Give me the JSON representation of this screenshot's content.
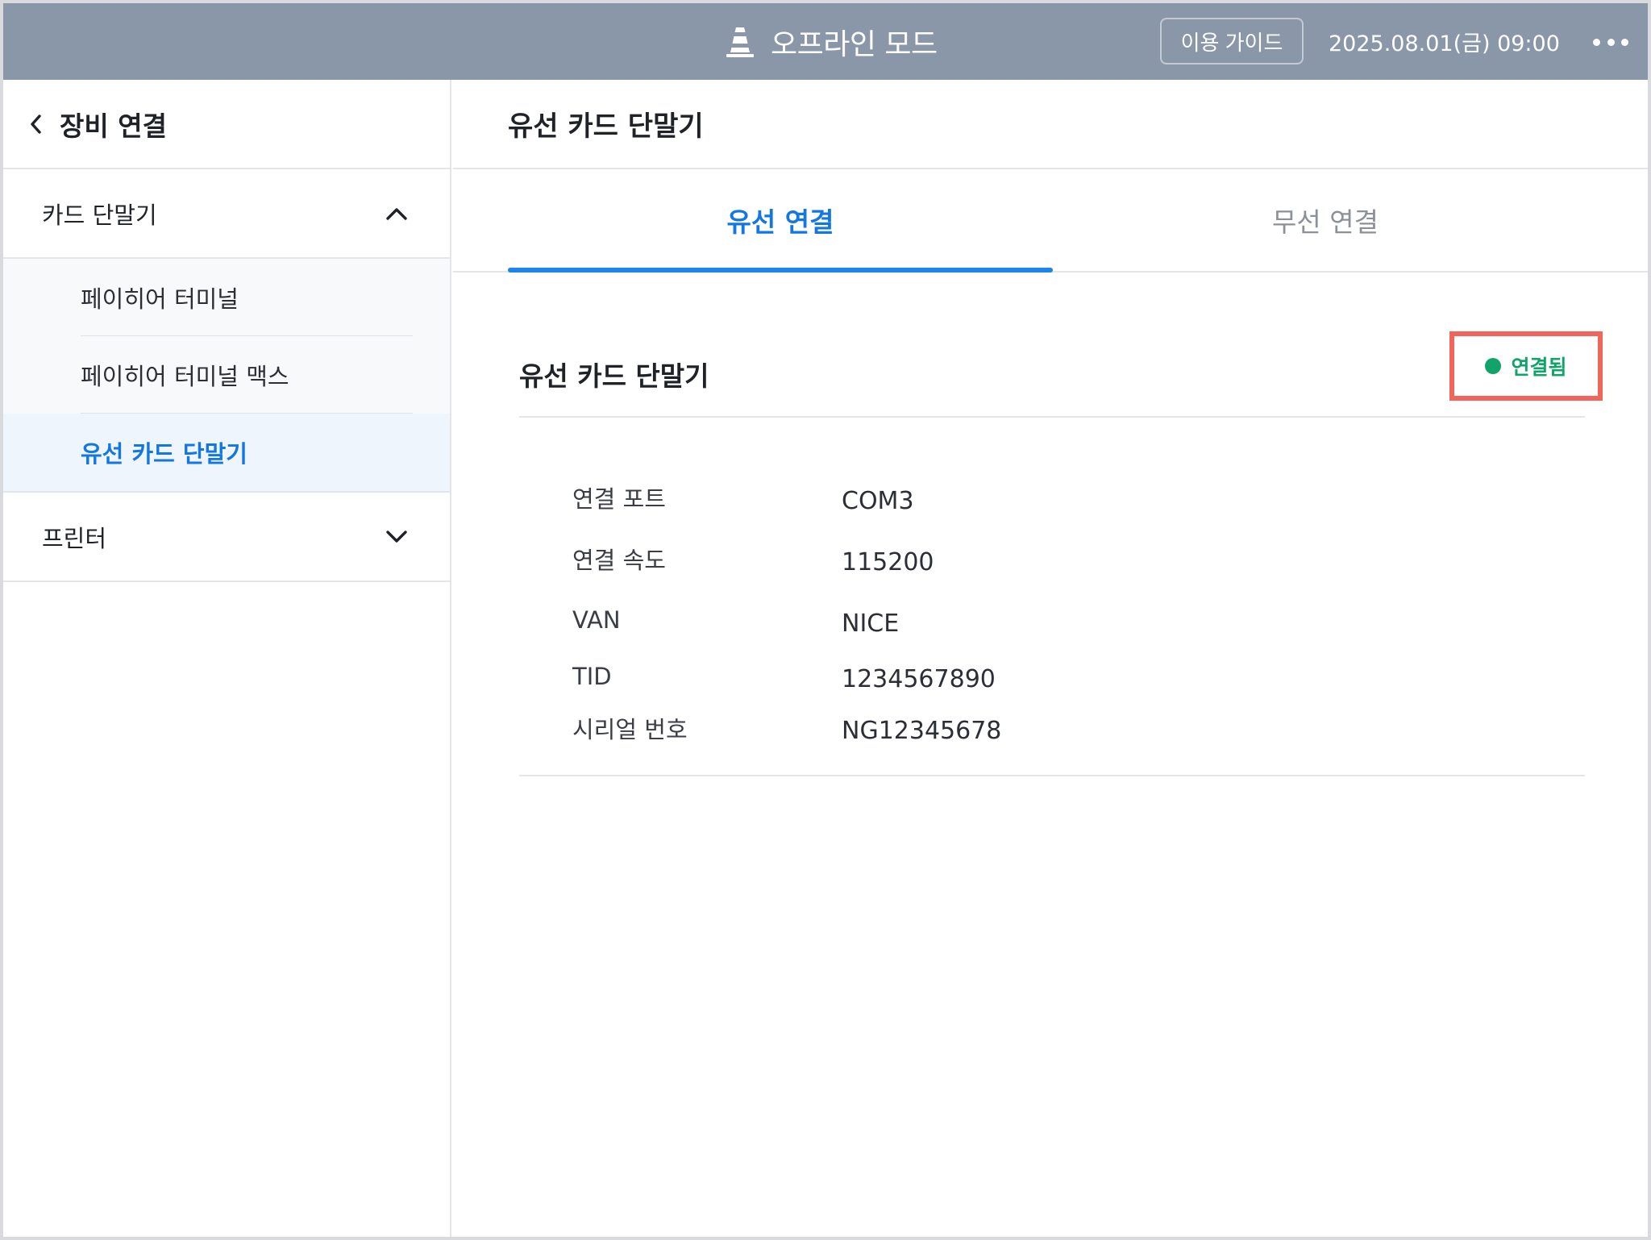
{
  "topbar": {
    "title": "오프라인 모드",
    "guide_label": "이용 가이드",
    "datetime": "2025.08.01(금) 09:00"
  },
  "sidebar": {
    "title": "장비 연결",
    "groups": [
      {
        "label": "카드 단말기",
        "expanded": true,
        "items": [
          {
            "label": "페이히어 터미널"
          },
          {
            "label": "페이히어 터미널 맥스"
          },
          {
            "label": "유선 카드 단말기",
            "active": true
          }
        ]
      },
      {
        "label": "프린터",
        "expanded": false
      }
    ]
  },
  "main": {
    "title": "유선 카드 단말기",
    "tabs": [
      {
        "label": "유선 연결",
        "active": true
      },
      {
        "label": "무선 연결",
        "active": false
      }
    ],
    "device": {
      "title": "유선 카드 단말기",
      "status": "연결됨",
      "status_color": "#12a36a"
    },
    "info": [
      {
        "label": "연결 포트",
        "value": "COM3"
      },
      {
        "label": "연결 속도",
        "value": "115200"
      },
      {
        "label": "VAN",
        "value": "NICE"
      },
      {
        "label": "TID",
        "value": "1234567890"
      },
      {
        "label": "시리얼 번호",
        "value": "NG12345678"
      }
    ]
  },
  "colors": {
    "topbar_bg": "#8a97a8",
    "accent": "#1477e0",
    "highlight_border": "#f2655a"
  }
}
